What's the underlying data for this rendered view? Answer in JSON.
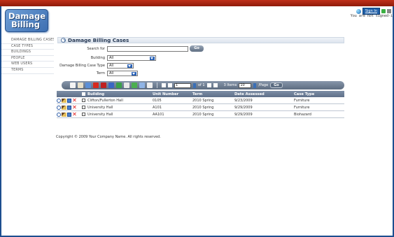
{
  "app": {
    "logo_line1": "Damage",
    "logo_line2": "Billing",
    "signin_label": "Sign In",
    "signed_status": "You are not signed-i"
  },
  "sidebar": {
    "items": [
      {
        "label": "DAMAGE BILLING CASES"
      },
      {
        "label": "CASE TYPES"
      },
      {
        "label": "BUILDINGS"
      },
      {
        "label": "PEOPLE"
      },
      {
        "label": "WEB USERS"
      },
      {
        "label": "TERMS"
      }
    ]
  },
  "page": {
    "title": "Damage Billing Cases"
  },
  "filters": {
    "search_label": "Search for",
    "search_value": "",
    "go_label": "Go",
    "building_label": "Building",
    "building_value": "All",
    "case_type_label": "Damage Billing Case Type",
    "case_type_value": "All",
    "term_label": "Term",
    "term_value": "All"
  },
  "pager": {
    "page_value": "1",
    "of_label": "of 1",
    "items_label": "3 Items",
    "page_size_value": "10",
    "per_page_label": "/Page",
    "go_label": "Go"
  },
  "table": {
    "headers": {
      "building": "Building",
      "unit": "Unit Number",
      "term": "Term",
      "date": "Date Assessed",
      "type": "Case Type"
    },
    "rows": [
      {
        "building": "Clifton/Fullerton Hall",
        "unit": "0105",
        "term": "2010 Spring",
        "date": "9/23/2009",
        "type": "Furniture"
      },
      {
        "building": "University Hall",
        "unit": "A101",
        "term": "2010 Spring",
        "date": "9/29/2009",
        "type": "Furniture"
      },
      {
        "building": "University Hall",
        "unit": "AA101",
        "term": "2010 Spring",
        "date": "9/29/2009",
        "type": "Biohazard"
      }
    ]
  },
  "footer": {
    "copyright": "Copyright © 2009 Your Company Name. All rights reserved."
  }
}
